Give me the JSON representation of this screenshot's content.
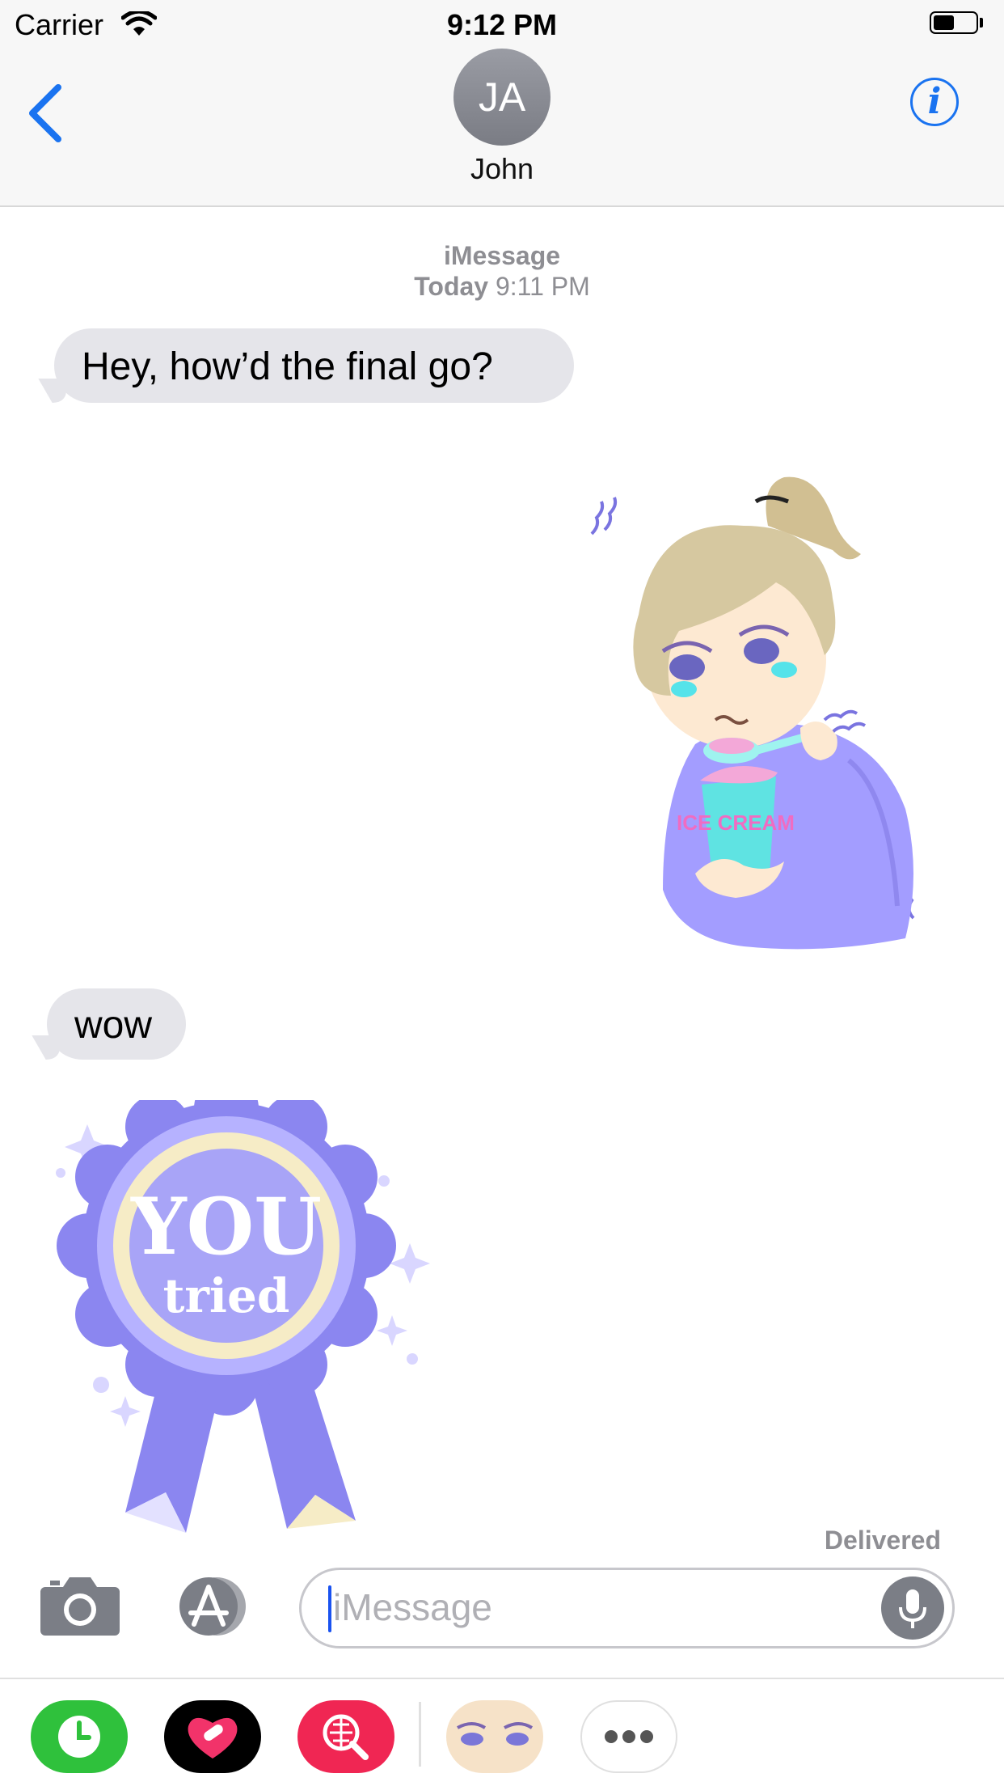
{
  "status_bar": {
    "carrier": "Carrier",
    "time": "9:12 PM",
    "battery_level": 0.5
  },
  "header": {
    "avatar_initials": "JA",
    "contact_name": "John"
  },
  "thread": {
    "service": "iMessage",
    "day": "Today",
    "time": "9:11 PM",
    "messages": [
      {
        "from": "John",
        "type": "text",
        "text": "Hey, how’d the final go?"
      },
      {
        "from": "me",
        "type": "sticker",
        "sticker_text": "ICE CREAM"
      },
      {
        "from": "John",
        "type": "text",
        "text": "wow"
      },
      {
        "from": "John",
        "type": "sticker",
        "sticker_text": "YOU tried"
      }
    ],
    "delivery_status": "Delivered"
  },
  "composer": {
    "placeholder": "iMessage"
  },
  "app_drawer": {
    "apps": [
      {
        "icon": "clock-app-icon",
        "color": "#2fc13c"
      },
      {
        "icon": "heart-app-icon",
        "color": "#000000"
      },
      {
        "icon": "search-globe-app-icon",
        "color": "#f02653"
      },
      {
        "icon": "sticker-face-app-icon",
        "color": "#f6e2c8"
      },
      {
        "icon": "more-icon",
        "color": "#ffffff"
      }
    ]
  },
  "colors": {
    "accent": "#1a73f0",
    "bubble_gray": "#e5e5ea",
    "meta_gray": "#8e8e93"
  }
}
